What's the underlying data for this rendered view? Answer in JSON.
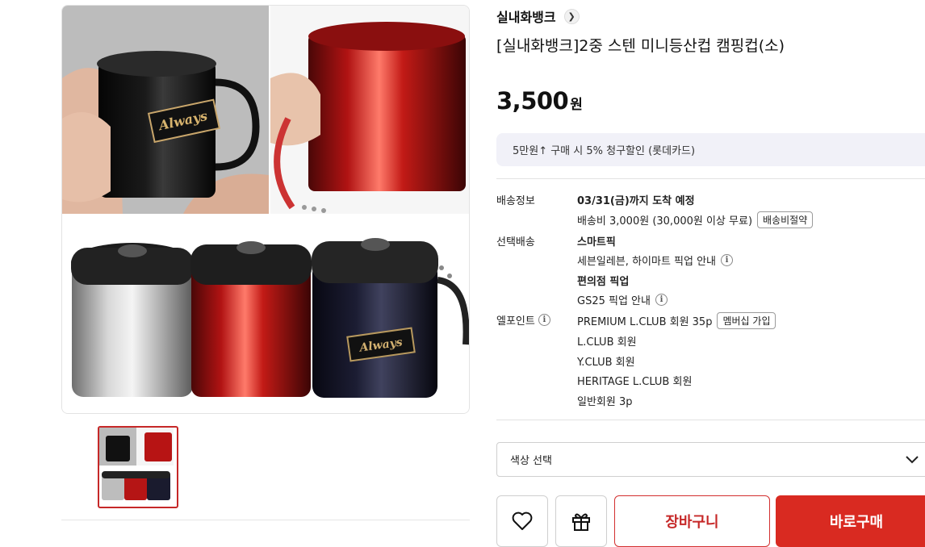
{
  "brand": {
    "name": "실내화뱅크",
    "arrow_icon": "chevron-right-icon"
  },
  "product": {
    "title": "[실내화뱅크]2중 스텐 미니등산컵 캠핑컵(소)"
  },
  "price": {
    "value": "3,500",
    "unit": "원"
  },
  "promo": {
    "text": "5만원↑ 구매 시 5% 청구할인 (롯데카드)"
  },
  "image_label": "Always",
  "delivery": {
    "label": "배송정보",
    "eta": "03/31(금)까지 도착 예정",
    "fee": "배송비 3,000원 (30,000원 이상 무료)",
    "fee_button": "배송비절약"
  },
  "pickup": {
    "label": "선택배송",
    "smart_pick_title": "스마트픽",
    "smart_pick_desc": "세븐일레븐, 하이마트 픽업 안내",
    "store_pick_title": "편의점 픽업",
    "store_pick_desc": "GS25 픽업 안내"
  },
  "lpoint": {
    "label": "엘포인트",
    "premium": "PREMIUM L.CLUB 회원 35p",
    "join_button": "멤버십 가입",
    "lclub": "L.CLUB 회원",
    "yclub": "Y.CLUB 회원",
    "heritage": "HERITAGE L.CLUB 회원",
    "regular": "일반회원 3p"
  },
  "color_select": {
    "placeholder": "색상 선택"
  },
  "actions": {
    "cart": "장바구니",
    "buy": "바로구매"
  },
  "colors": {
    "accent": "#d92a21",
    "promo_bg": "#f1f1f8"
  }
}
